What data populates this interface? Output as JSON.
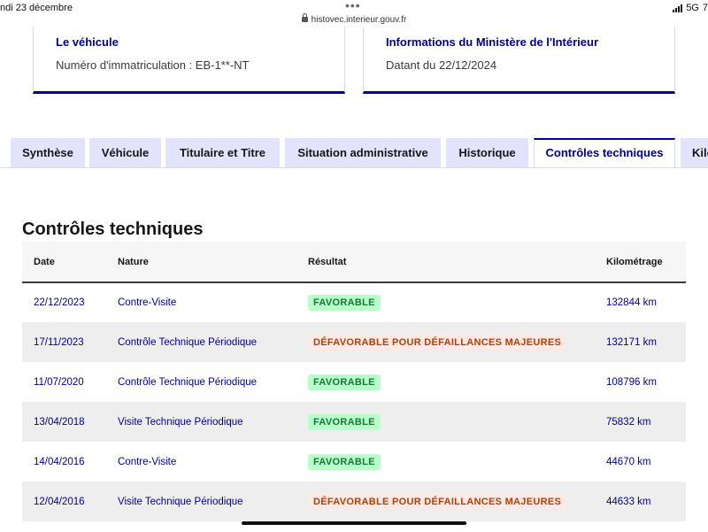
{
  "status_bar": {
    "date": "ndi 23 décembre",
    "url": "histovec.interieur.gouv.fr",
    "network": "5G",
    "battery_fragment": "7"
  },
  "cards": [
    {
      "title": "Le véhicule",
      "text": "Numéro d'immatriculation : EB-1**-NT"
    },
    {
      "title": "Informations du Ministère de l'Intérieur",
      "text": "Datant du 22/12/2024"
    }
  ],
  "tabs": [
    {
      "label": "Synthèse",
      "active": false
    },
    {
      "label": "Véhicule",
      "active": false
    },
    {
      "label": "Titulaire et Titre",
      "active": false
    },
    {
      "label": "Situation administrative",
      "active": false
    },
    {
      "label": "Historique",
      "active": false
    },
    {
      "label": "Contrôles techniques",
      "active": true
    },
    {
      "label": "Kilo",
      "active": false
    }
  ],
  "section_title": "Contrôles techniques",
  "table": {
    "headers": [
      "Date",
      "Nature",
      "Résultat",
      "Kilométrage"
    ],
    "rows": [
      {
        "date": "22/12/2023",
        "nature": "Contre-Visite",
        "result": "FAVORABLE",
        "status": "ok",
        "km": "132844 km"
      },
      {
        "date": "17/11/2023",
        "nature": "Contrôle Technique Périodique",
        "result": "DÉFAVORABLE POUR DÉFAILLANCES MAJEURES",
        "status": "bad",
        "km": "132171 km"
      },
      {
        "date": "11/07/2020",
        "nature": "Contrôle Technique Périodique",
        "result": "FAVORABLE",
        "status": "ok",
        "km": "108796 km"
      },
      {
        "date": "13/04/2018",
        "nature": "Visite Technique Périodique",
        "result": "FAVORABLE",
        "status": "ok",
        "km": "75832 km"
      },
      {
        "date": "14/04/2016",
        "nature": "Contre-Visite",
        "result": "FAVORABLE",
        "status": "ok",
        "km": "44670 km"
      },
      {
        "date": "12/04/2016",
        "nature": "Visite Technique Périodique",
        "result": "DÉFAVORABLE POUR DÉFAILLANCES MAJEURES",
        "status": "bad",
        "km": "44633 km"
      }
    ]
  },
  "colors": {
    "primary": "#000091",
    "tab_inactive_bg": "#e3e3fd",
    "success_bg": "#b8fec9",
    "success_text": "#18753c",
    "error_bg": "#ffe9e6",
    "error_text": "#b34000"
  },
  "icons": {
    "lock": "lock-icon",
    "signal": "signal-bars-icon"
  }
}
